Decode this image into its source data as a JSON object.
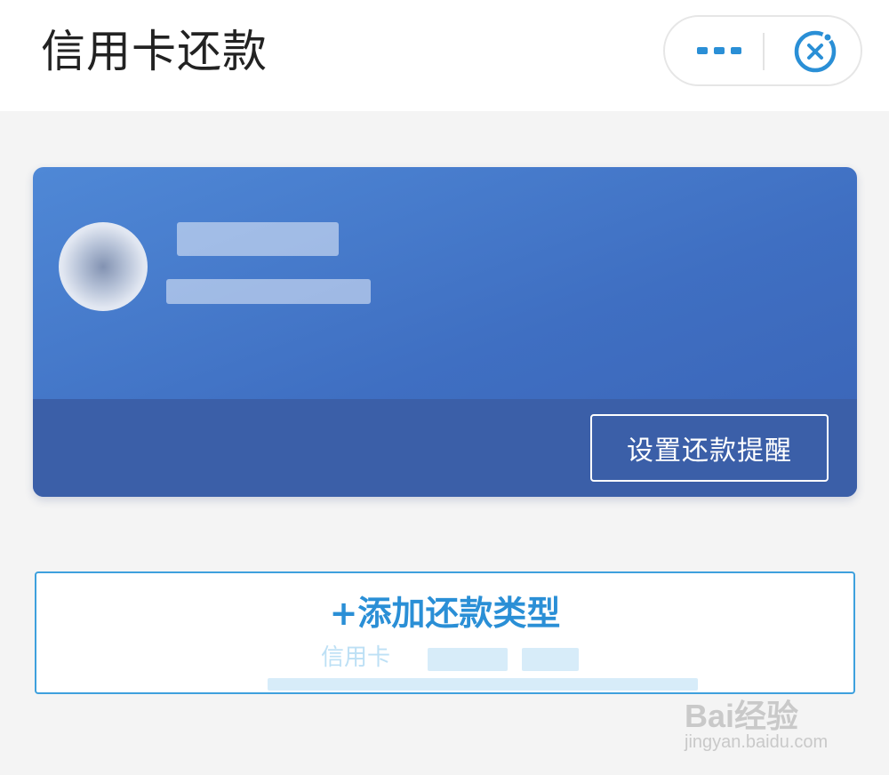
{
  "header": {
    "title": "信用卡还款",
    "more_icon": "more-dots-icon",
    "close_icon": "close-circle-icon"
  },
  "card": {
    "remind_label": "设置还款提醒",
    "avatar_icon": "bank-logo"
  },
  "add_type": {
    "label": "+添加还款类型",
    "sub_label": "信用卡"
  },
  "watermark": {
    "text": "Bai经验",
    "url": "jingyan.baidu.com"
  },
  "colors": {
    "accent": "#2a8fd6",
    "card_blue": "#4f88d6",
    "card_bottom": "#3b5fa8",
    "border_blue": "#3ea0dd"
  }
}
